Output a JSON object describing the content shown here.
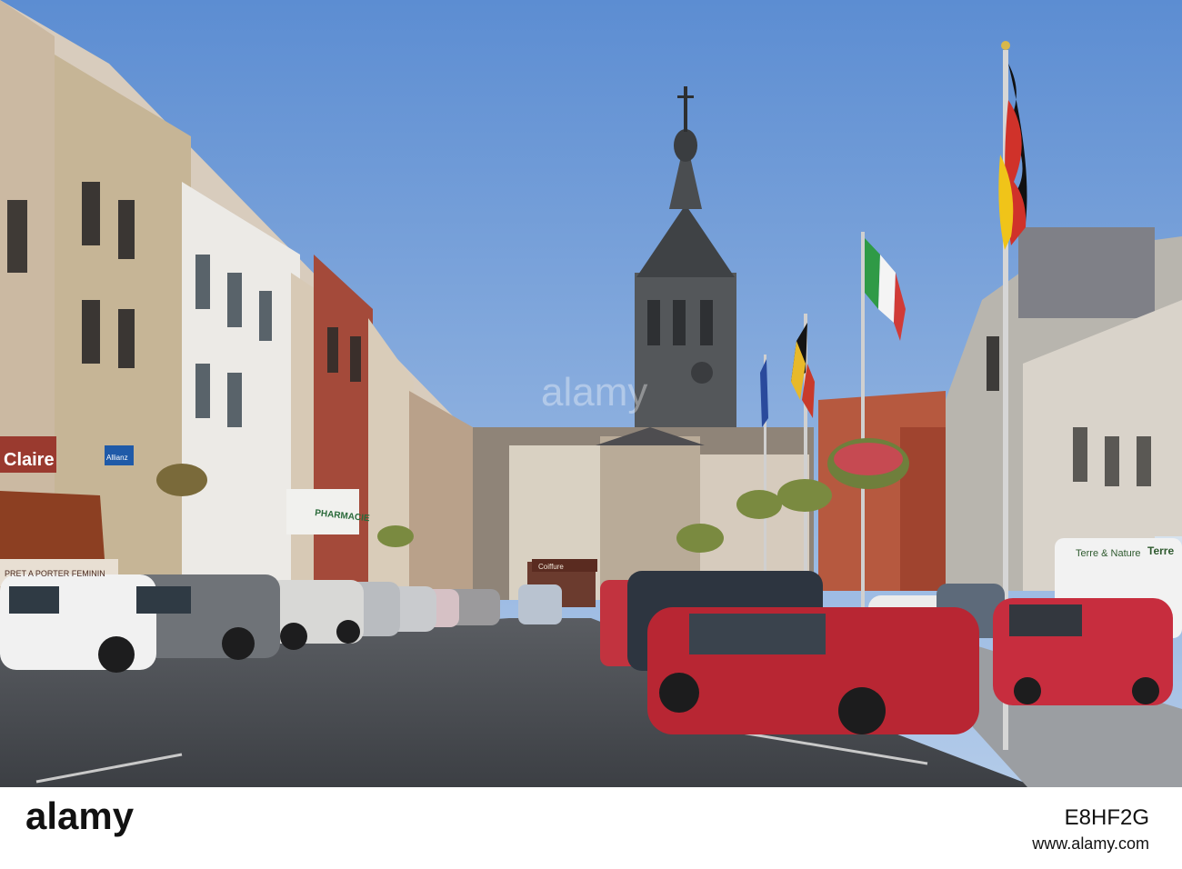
{
  "scene": {
    "description_tag": "town-square-street",
    "colors": {
      "sky_top": "#5f8ed1",
      "sky_bottom": "#a9c5e8",
      "road": "#4a4d52",
      "church_stone": "#5a5c5e"
    },
    "flags": [
      "germany-flag",
      "italy-flag",
      "belgium-flag",
      "eu-flag"
    ]
  },
  "shop_signs": {
    "claire": "Claire",
    "pret_a_porter": "PRET A PORTER FEMININ",
    "allianz": "Allianz",
    "pharmacie": "PHARMACIE",
    "terre_nature": "Terre & Nature",
    "terre": "Terre",
    "coiffure": "Coiffure"
  },
  "watermark": {
    "text": "alamy"
  },
  "footer": {
    "brand": "alamy",
    "image_id": "E8HF2G",
    "url": "www.alamy.com"
  }
}
